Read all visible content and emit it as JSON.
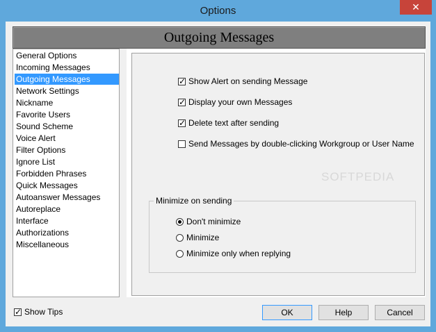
{
  "window": {
    "title": "Options",
    "close_glyph": "✕"
  },
  "header": {
    "title": "Outgoing Messages"
  },
  "sidebar": {
    "items": [
      {
        "label": "General Options"
      },
      {
        "label": "Incoming Messages"
      },
      {
        "label": "Outgoing Messages"
      },
      {
        "label": "Network Settings"
      },
      {
        "label": "Nickname"
      },
      {
        "label": "Favorite Users"
      },
      {
        "label": "Sound Scheme"
      },
      {
        "label": "Voice Alert"
      },
      {
        "label": "Filter Options"
      },
      {
        "label": "Ignore List"
      },
      {
        "label": "Forbidden Phrases"
      },
      {
        "label": "Quick Messages"
      },
      {
        "label": "Autoanswer Messages"
      },
      {
        "label": "Autoreplace"
      },
      {
        "label": "Interface"
      },
      {
        "label": "Authorizations"
      },
      {
        "label": "Miscellaneous"
      }
    ],
    "selected": "Outgoing Messages"
  },
  "options": {
    "checkboxes": [
      {
        "label": "Show Alert on sending Message",
        "checked": true
      },
      {
        "label": "Display your own Messages",
        "checked": true
      },
      {
        "label": "Delete text after sending",
        "checked": true
      },
      {
        "label": "Send Messages by double-clicking Workgroup or User Name",
        "checked": false
      }
    ],
    "minimize_group": {
      "legend": "Minimize on sending",
      "radios": [
        {
          "label": "Don't minimize",
          "selected": true
        },
        {
          "label": "Minimize",
          "selected": false
        },
        {
          "label": "Minimize only when replying",
          "selected": false
        }
      ]
    }
  },
  "watermark": "SOFTPEDIA",
  "footer": {
    "show_tips": {
      "label": "Show Tips",
      "checked": true
    },
    "ok_label": "OK",
    "help_label": "Help",
    "cancel_label": "Cancel"
  },
  "colors": {
    "titlebar": "#5fa8dc",
    "close_button": "#c7443a",
    "selection": "#3399ff",
    "header_banner": "#7f7f7f"
  }
}
